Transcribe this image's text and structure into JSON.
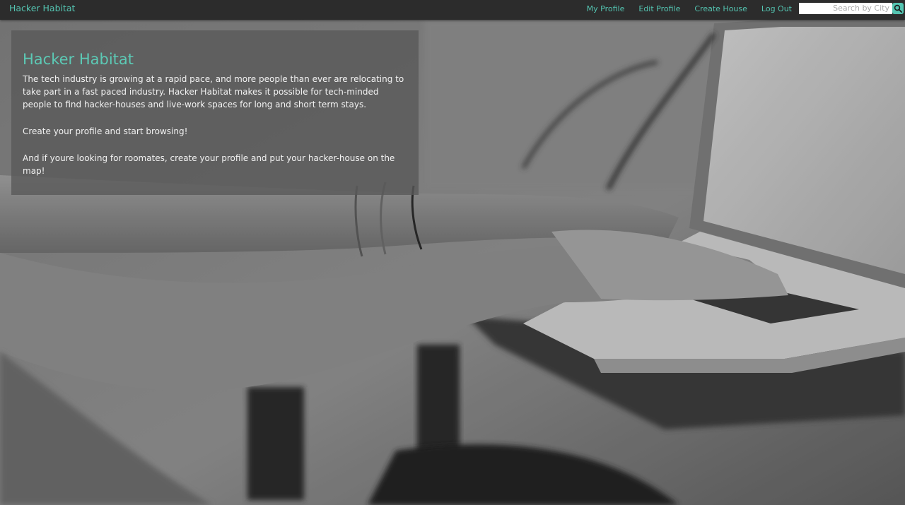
{
  "navbar": {
    "brand": "Hacker Habitat",
    "links": [
      {
        "label": "My Profile"
      },
      {
        "label": "Edit Profile"
      },
      {
        "label": "Create House"
      },
      {
        "label": "Log Out"
      }
    ],
    "search": {
      "placeholder": "Search by City",
      "value": ""
    }
  },
  "intro": {
    "title": "Hacker Habitat",
    "paragraphs": [
      "The tech industry is growing at a rapid pace, and more people than ever are relocating to take part in a fast paced industry. Hacker Habitat makes it possible for tech-minded people to find hacker-houses and live-work spaces for long and short term stays.",
      "Create your profile and start browsing!",
      "And if youre looking for roomates, create your profile and put your hacker-house on the map!"
    ]
  },
  "colors": {
    "accent": "#54c4b1",
    "navbar_bg": "#2c2c2c",
    "card_bg": "#585858"
  },
  "icons": {
    "search": "search-icon"
  }
}
